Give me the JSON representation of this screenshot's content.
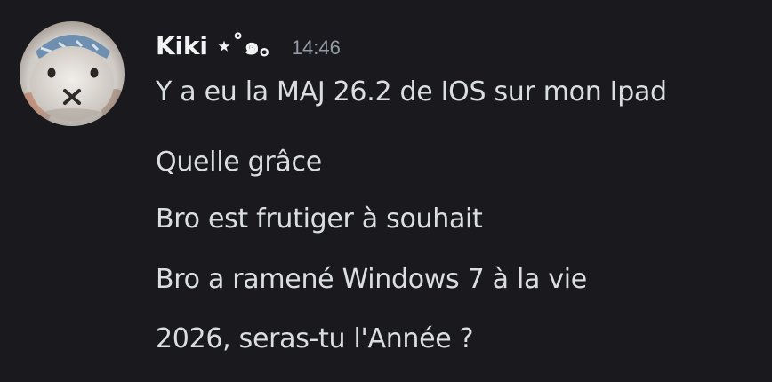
{
  "author": {
    "name": "Kiki ⋆˚๑｡",
    "avatar_icon": "bunny-plush-avatar-icon"
  },
  "timestamp": "14:46",
  "messages": [
    "Y a eu la MAJ 26.2 de IOS sur mon Ipad",
    "Quelle grâce",
    "Bro est frutiger à souhait",
    "Bro a ramené Windows 7 à la vie",
    "2026, seras-tu l'Année ?"
  ],
  "colors": {
    "background": "#1a1a1e",
    "username": "#f2f3f5",
    "timestamp": "#949ba4",
    "message_text": "#dbdee1"
  }
}
